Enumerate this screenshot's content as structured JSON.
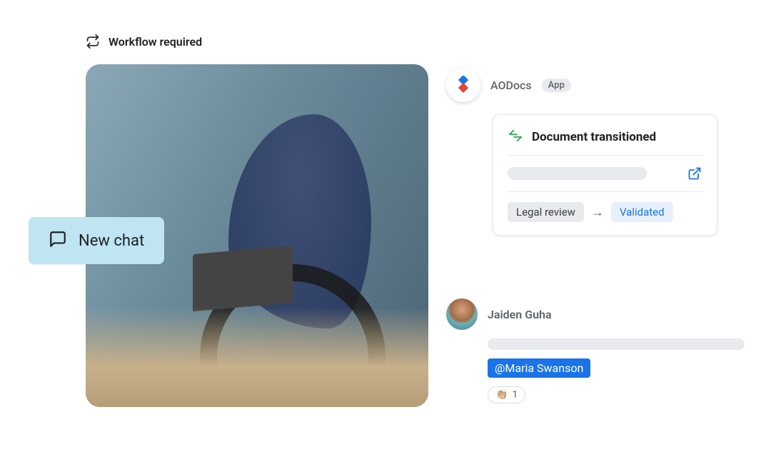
{
  "workflow": {
    "label": "Workflow required"
  },
  "newChat": {
    "label": "New chat"
  },
  "aodocs": {
    "name": "AODocs",
    "badge": "App"
  },
  "card": {
    "title": "Document transitioned",
    "statusFrom": "Legal review",
    "statusTo": "Validated"
  },
  "message": {
    "author": "Jaiden Guha",
    "mention": "@Maria Swanson",
    "reaction": {
      "emoji": "👏🏼",
      "count": "1"
    }
  }
}
